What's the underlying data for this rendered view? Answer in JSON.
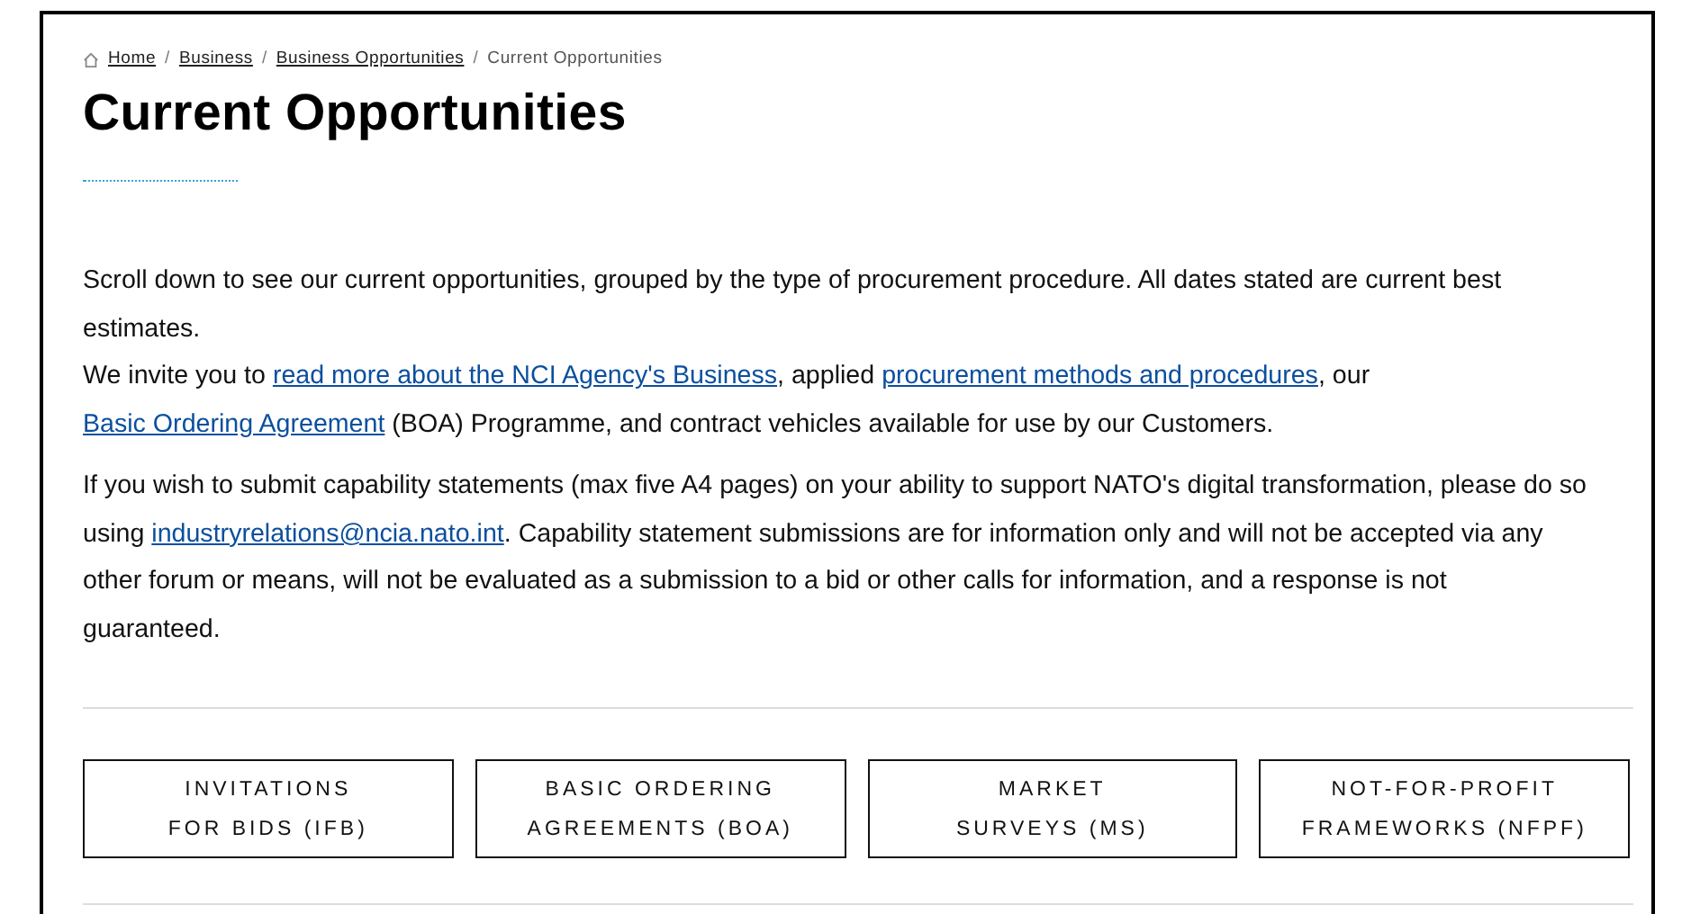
{
  "breadcrumb": [
    {
      "label": "Home",
      "link": true
    },
    {
      "separator": "/",
      "label": "Business",
      "link": true
    },
    {
      "separator": "/",
      "label": "Business Opportunities",
      "link": true
    },
    {
      "separator": "/",
      "label": "Current Opportunities",
      "link": false
    }
  ],
  "title": "Current Opportunities",
  "paragraphs": [
    [
      {
        "kind": "text",
        "text": "Scroll down to see our current opportunities, grouped by the type of procurement procedure. All dates stated are current best estimates."
      }
    ],
    [
      {
        "kind": "text",
        "text": "We invite you to "
      },
      {
        "kind": "link",
        "text": "read more about the NCI Agency's Business"
      },
      {
        "kind": "text",
        "text": ", applied "
      },
      {
        "kind": "link",
        "text": "procurement methods and procedures"
      },
      {
        "kind": "text",
        "text": ", our "
      },
      {
        "kind": "link",
        "text": "Basic Ordering Agreement"
      },
      {
        "kind": "text",
        "text": " (BOA) Programme, and contract vehicles available for use by our Customers."
      }
    ],
    [
      {
        "kind": "text",
        "text": "If you wish to submit capability statements (max five A4 pages) on your ability to support NATO's digital transformation, please do so using "
      },
      {
        "kind": "link",
        "text": "industryrelations@ncia.nato.int"
      },
      {
        "kind": "text",
        "text": ". Capability statement submissions are for information only and will not be accepted via any other forum or means, will not be evaluated as a submission to a bid or other calls for information, and a response is not guaranteed."
      }
    ]
  ],
  "procedure_buttons": [
    [
      "INVITATIONS",
      "FOR BIDS (IFB)"
    ],
    [
      "BASIC ORDERING",
      "AGREEMENTS (BOA)"
    ],
    [
      "MARKET",
      "SURVEYS (MS)"
    ],
    [
      "NOT-FOR-PROFIT",
      "FRAMEWORKS (NFPF)"
    ]
  ]
}
